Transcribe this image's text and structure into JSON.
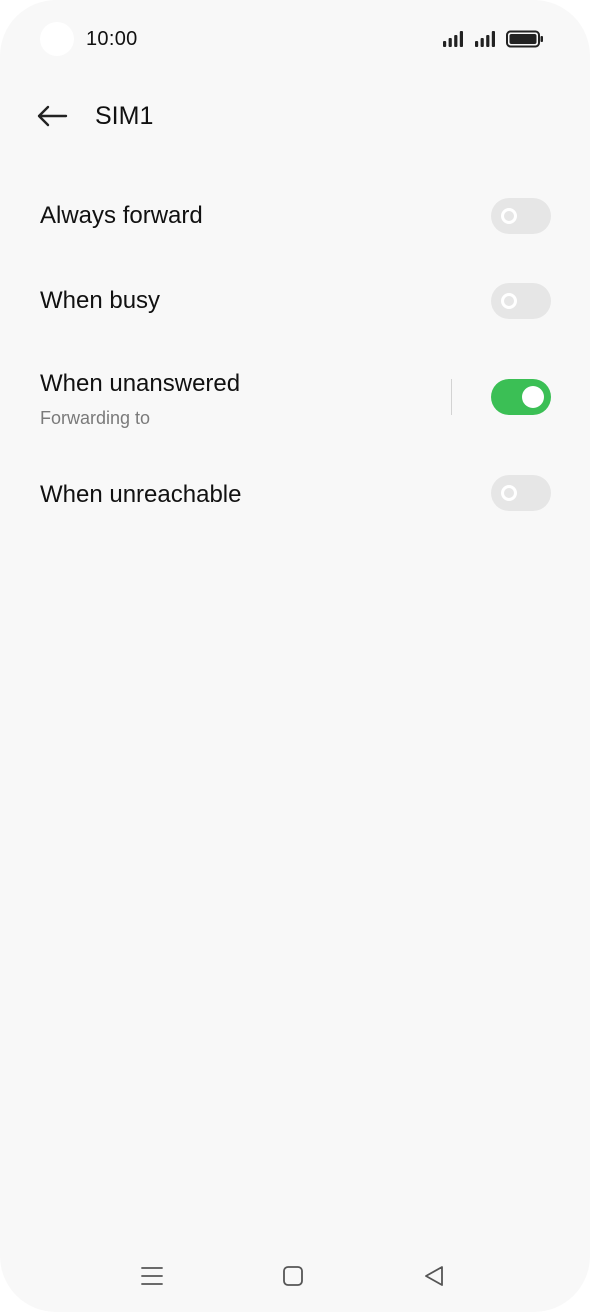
{
  "status_bar": {
    "time": "10:00",
    "icons": [
      "signal-icon",
      "signal-icon",
      "battery-icon"
    ]
  },
  "header": {
    "back_icon": "arrow-left-icon",
    "title": "SIM1"
  },
  "settings": {
    "items": [
      {
        "label": "Always forward",
        "subtitle": "",
        "enabled": false
      },
      {
        "label": "When busy",
        "subtitle": "",
        "enabled": false
      },
      {
        "label": "When unanswered",
        "subtitle": "Forwarding to",
        "enabled": true
      },
      {
        "label": "When unreachable",
        "subtitle": "",
        "enabled": false
      }
    ]
  },
  "nav_bar": {
    "icons": [
      "menu-icon",
      "home-icon",
      "back-triangle-icon"
    ]
  },
  "colors": {
    "background": "#f8f8f8",
    "toggle_on": "#3bbf55",
    "toggle_off": "#e6e6e6",
    "text_primary": "#111111",
    "text_secondary": "#7a7a7a"
  }
}
